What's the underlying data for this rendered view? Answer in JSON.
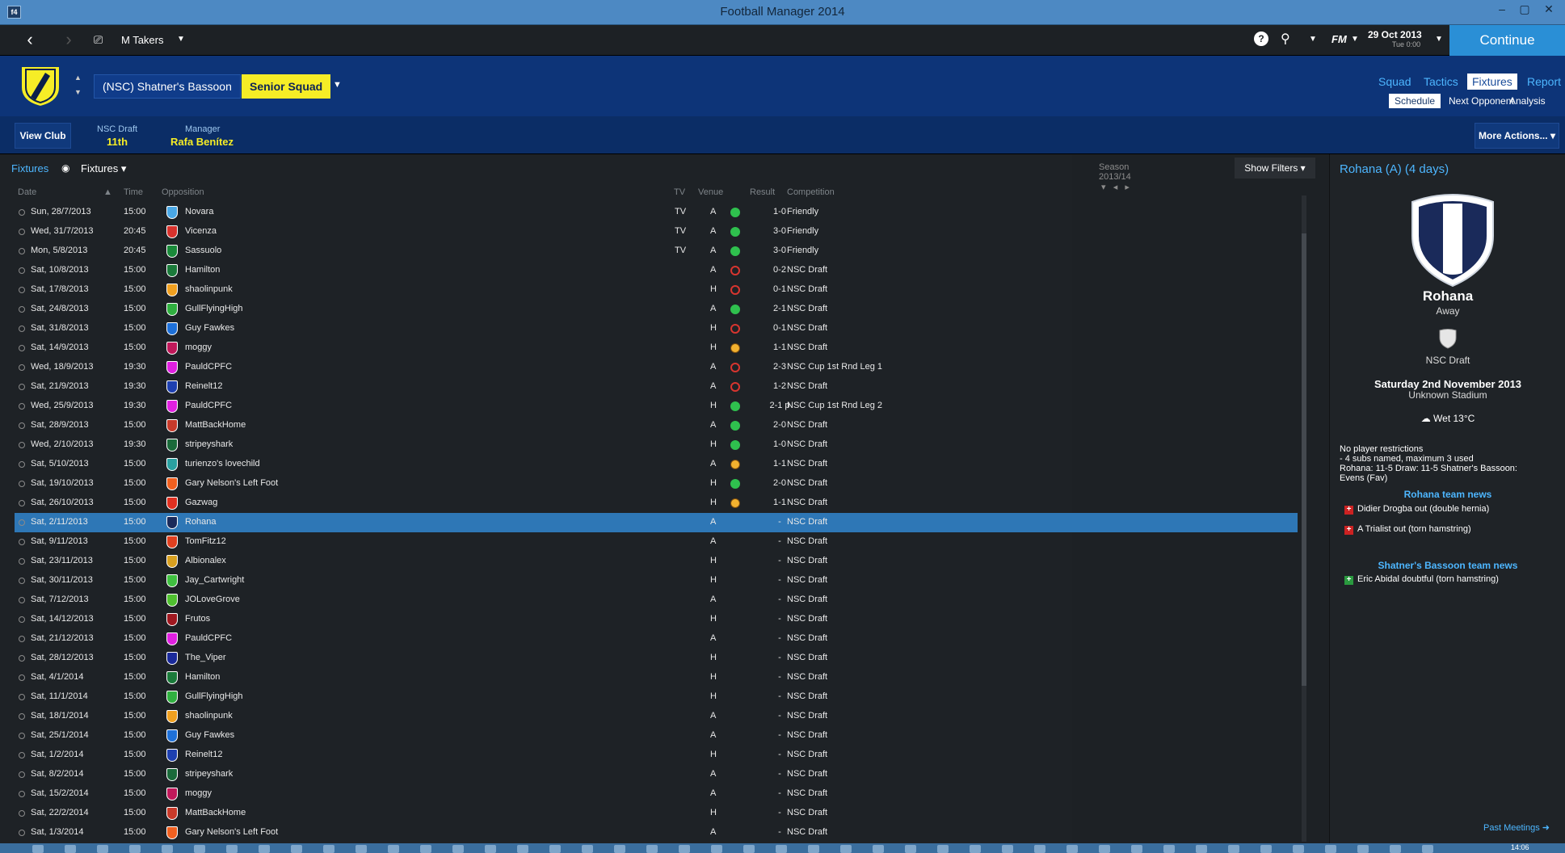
{
  "window": {
    "title": "Football Manager 2014",
    "app_icon": "fm-icon"
  },
  "topbar": {
    "manager": "M Takers",
    "date": "29 Oct 2013",
    "time": "Tue 0:00",
    "fm_label": "FM",
    "continue_label": "Continue"
  },
  "header": {
    "club_name": "(NSC) Shatner's Bassoon",
    "squad": "Senior Squad",
    "nav": [
      "Squad",
      "Tactics",
      "Fixtures",
      "Report"
    ],
    "subnav": [
      "Schedule",
      "Next Opponent",
      "Analysis"
    ],
    "view_club": "View Club",
    "league_label": "NSC Draft",
    "league_pos": "11th",
    "manager_label": "Manager",
    "manager_name": "Rafa Benítez",
    "more_actions": "More Actions..."
  },
  "fixtures": {
    "breadcrumb": "Fixtures",
    "tab": "Fixtures",
    "season": "Season 2013/14",
    "show_filters": "Show Filters",
    "columns": [
      "Date",
      "Time",
      "Opposition",
      "TV",
      "Venue",
      "Result",
      "Competition"
    ],
    "rows": [
      {
        "date": "Sun, 28/7/2013",
        "time": "15:00",
        "opp": "Novara",
        "tv": "TV",
        "venue": "A",
        "res": "1-0",
        "outcome": "win",
        "comp": "Friendly",
        "color": "#4aa8e6"
      },
      {
        "date": "Wed, 31/7/2013",
        "time": "20:45",
        "opp": "Vicenza",
        "tv": "TV",
        "venue": "A",
        "res": "3-0",
        "outcome": "win",
        "comp": "Friendly",
        "color": "#d8322d"
      },
      {
        "date": "Mon, 5/8/2013",
        "time": "20:45",
        "opp": "Sassuolo",
        "tv": "TV",
        "venue": "A",
        "res": "3-0",
        "outcome": "win",
        "comp": "Friendly",
        "color": "#1a8a3a"
      },
      {
        "date": "Sat, 10/8/2013",
        "time": "15:00",
        "opp": "Hamilton",
        "tv": "",
        "venue": "A",
        "res": "0-2",
        "outcome": "loss",
        "comp": "NSC Draft",
        "color": "#1a7a3a"
      },
      {
        "date": "Sat, 17/8/2013",
        "time": "15:00",
        "opp": "shaolinpunk",
        "tv": "",
        "venue": "H",
        "res": "0-1",
        "outcome": "loss",
        "comp": "NSC Draft",
        "color": "#f0a020"
      },
      {
        "date": "Sat, 24/8/2013",
        "time": "15:00",
        "opp": "GullFlyingHigh",
        "tv": "",
        "venue": "A",
        "res": "2-1",
        "outcome": "win",
        "comp": "NSC Draft",
        "color": "#30b040"
      },
      {
        "date": "Sat, 31/8/2013",
        "time": "15:00",
        "opp": "Guy Fawkes",
        "tv": "",
        "venue": "H",
        "res": "0-1",
        "outcome": "loss",
        "comp": "NSC Draft",
        "color": "#1e70d8"
      },
      {
        "date": "Sat, 14/9/2013",
        "time": "15:00",
        "opp": "moggy",
        "tv": "",
        "venue": "H",
        "res": "1-1",
        "outcome": "draw",
        "comp": "NSC Draft",
        "color": "#c0185a"
      },
      {
        "date": "Wed, 18/9/2013",
        "time": "19:30",
        "opp": "PauldCPFC",
        "tv": "",
        "venue": "A",
        "res": "2-3",
        "outcome": "loss",
        "comp": "NSC Cup 1st Rnd Leg 1",
        "color": "#e020e0"
      },
      {
        "date": "Sat, 21/9/2013",
        "time": "19:30",
        "opp": "Reinelt12",
        "tv": "",
        "venue": "A",
        "res": "1-2",
        "outcome": "loss",
        "comp": "NSC Draft",
        "color": "#1e40b0"
      },
      {
        "date": "Wed, 25/9/2013",
        "time": "19:30",
        "opp": "PauldCPFC",
        "tv": "",
        "venue": "H",
        "res": "2-1 p",
        "outcome": "win",
        "comp": "NSC Cup 1st Rnd Leg 2",
        "color": "#e020e0"
      },
      {
        "date": "Sat, 28/9/2013",
        "time": "15:00",
        "opp": "MattBackHome",
        "tv": "",
        "venue": "A",
        "res": "2-0",
        "outcome": "win",
        "comp": "NSC Draft",
        "color": "#c83a2a"
      },
      {
        "date": "Wed, 2/10/2013",
        "time": "19:30",
        "opp": "stripeyshark",
        "tv": "",
        "venue": "H",
        "res": "1-0",
        "outcome": "win",
        "comp": "NSC Draft",
        "color": "#1a6a3a"
      },
      {
        "date": "Sat, 5/10/2013",
        "time": "15:00",
        "opp": "turienzo's lovechild",
        "tv": "",
        "venue": "A",
        "res": "1-1",
        "outcome": "draw",
        "comp": "NSC Draft",
        "color": "#2aa0a0"
      },
      {
        "date": "Sat, 19/10/2013",
        "time": "15:00",
        "opp": "Gary Nelson's Left Foot",
        "tv": "",
        "venue": "H",
        "res": "2-0",
        "outcome": "win",
        "comp": "NSC Draft",
        "color": "#f06020"
      },
      {
        "date": "Sat, 26/10/2013",
        "time": "15:00",
        "opp": "Gazwag",
        "tv": "",
        "venue": "H",
        "res": "1-1",
        "outcome": "draw",
        "comp": "NSC Draft",
        "color": "#e03020"
      },
      {
        "date": "Sat, 2/11/2013",
        "time": "15:00",
        "opp": "Rohana",
        "tv": "",
        "venue": "A",
        "res": "-",
        "outcome": "",
        "comp": "NSC Draft",
        "color": "#1a2a5a"
      },
      {
        "date": "Sat, 9/11/2013",
        "time": "15:00",
        "opp": "TomFitz12",
        "tv": "",
        "venue": "A",
        "res": "-",
        "outcome": "",
        "comp": "NSC Draft",
        "color": "#e04020"
      },
      {
        "date": "Sat, 23/11/2013",
        "time": "15:00",
        "opp": "Albionalex",
        "tv": "",
        "venue": "H",
        "res": "-",
        "outcome": "",
        "comp": "NSC Draft",
        "color": "#d8a020"
      },
      {
        "date": "Sat, 30/11/2013",
        "time": "15:00",
        "opp": "Jay_Cartwright",
        "tv": "",
        "venue": "H",
        "res": "-",
        "outcome": "",
        "comp": "NSC Draft",
        "color": "#40c040"
      },
      {
        "date": "Sat, 7/12/2013",
        "time": "15:00",
        "opp": "JOLoveGrove",
        "tv": "",
        "venue": "A",
        "res": "-",
        "outcome": "",
        "comp": "NSC Draft",
        "color": "#50c030"
      },
      {
        "date": "Sat, 14/12/2013",
        "time": "15:00",
        "opp": "Frutos",
        "tv": "",
        "venue": "H",
        "res": "-",
        "outcome": "",
        "comp": "NSC Draft",
        "color": "#a01820"
      },
      {
        "date": "Sat, 21/12/2013",
        "time": "15:00",
        "opp": "PauldCPFC",
        "tv": "",
        "venue": "A",
        "res": "-",
        "outcome": "",
        "comp": "NSC Draft",
        "color": "#e020e0"
      },
      {
        "date": "Sat, 28/12/2013",
        "time": "15:00",
        "opp": "The_Viper",
        "tv": "",
        "venue": "H",
        "res": "-",
        "outcome": "",
        "comp": "NSC Draft",
        "color": "#1a2a9a"
      },
      {
        "date": "Sat, 4/1/2014",
        "time": "15:00",
        "opp": "Hamilton",
        "tv": "",
        "venue": "H",
        "res": "-",
        "outcome": "",
        "comp": "NSC Draft",
        "color": "#1a7a3a"
      },
      {
        "date": "Sat, 11/1/2014",
        "time": "15:00",
        "opp": "GullFlyingHigh",
        "tv": "",
        "venue": "H",
        "res": "-",
        "outcome": "",
        "comp": "NSC Draft",
        "color": "#30b040"
      },
      {
        "date": "Sat, 18/1/2014",
        "time": "15:00",
        "opp": "shaolinpunk",
        "tv": "",
        "venue": "A",
        "res": "-",
        "outcome": "",
        "comp": "NSC Draft",
        "color": "#f0a020"
      },
      {
        "date": "Sat, 25/1/2014",
        "time": "15:00",
        "opp": "Guy Fawkes",
        "tv": "",
        "venue": "A",
        "res": "-",
        "outcome": "",
        "comp": "NSC Draft",
        "color": "#1e70d8"
      },
      {
        "date": "Sat, 1/2/2014",
        "time": "15:00",
        "opp": "Reinelt12",
        "tv": "",
        "venue": "H",
        "res": "-",
        "outcome": "",
        "comp": "NSC Draft",
        "color": "#1e40b0"
      },
      {
        "date": "Sat, 8/2/2014",
        "time": "15:00",
        "opp": "stripeyshark",
        "tv": "",
        "venue": "A",
        "res": "-",
        "outcome": "",
        "comp": "NSC Draft",
        "color": "#1a6a3a"
      },
      {
        "date": "Sat, 15/2/2014",
        "time": "15:00",
        "opp": "moggy",
        "tv": "",
        "venue": "A",
        "res": "-",
        "outcome": "",
        "comp": "NSC Draft",
        "color": "#c0185a"
      },
      {
        "date": "Sat, 22/2/2014",
        "time": "15:00",
        "opp": "MattBackHome",
        "tv": "",
        "venue": "H",
        "res": "-",
        "outcome": "",
        "comp": "NSC Draft",
        "color": "#c83a2a"
      },
      {
        "date": "Sat, 1/3/2014",
        "time": "15:00",
        "opp": "Gary Nelson's Left Foot",
        "tv": "",
        "venue": "A",
        "res": "-",
        "outcome": "",
        "comp": "NSC Draft",
        "color": "#f06020"
      }
    ],
    "selected_index": 16
  },
  "side": {
    "header": "Rohana (A) (4 days)",
    "club": "Rohana",
    "venue": "Away",
    "competition": "NSC Draft",
    "match_date": "Saturday 2nd November 2013",
    "stadium": "Unknown Stadium",
    "weather": "Wet 13°C",
    "restrictions": [
      "No player restrictions",
      "- 4 subs named, maximum 3 used",
      "Rohana: 11-5 Draw: 11-5 Shatner's Bassoon:",
      "Evens (Fav)"
    ],
    "opp_news_header": "Rohana team news",
    "opp_news": [
      "Didier Drogba out (double hernia)",
      "A Trialist out (torn hamstring)"
    ],
    "own_news_header": "Shatner's Bassoon team news",
    "own_news": [
      "Eric Abidal doubtful (torn hamstring)"
    ],
    "past_meetings": "Past Meetings ➜"
  },
  "taskbar": {
    "clock": "14:06"
  }
}
